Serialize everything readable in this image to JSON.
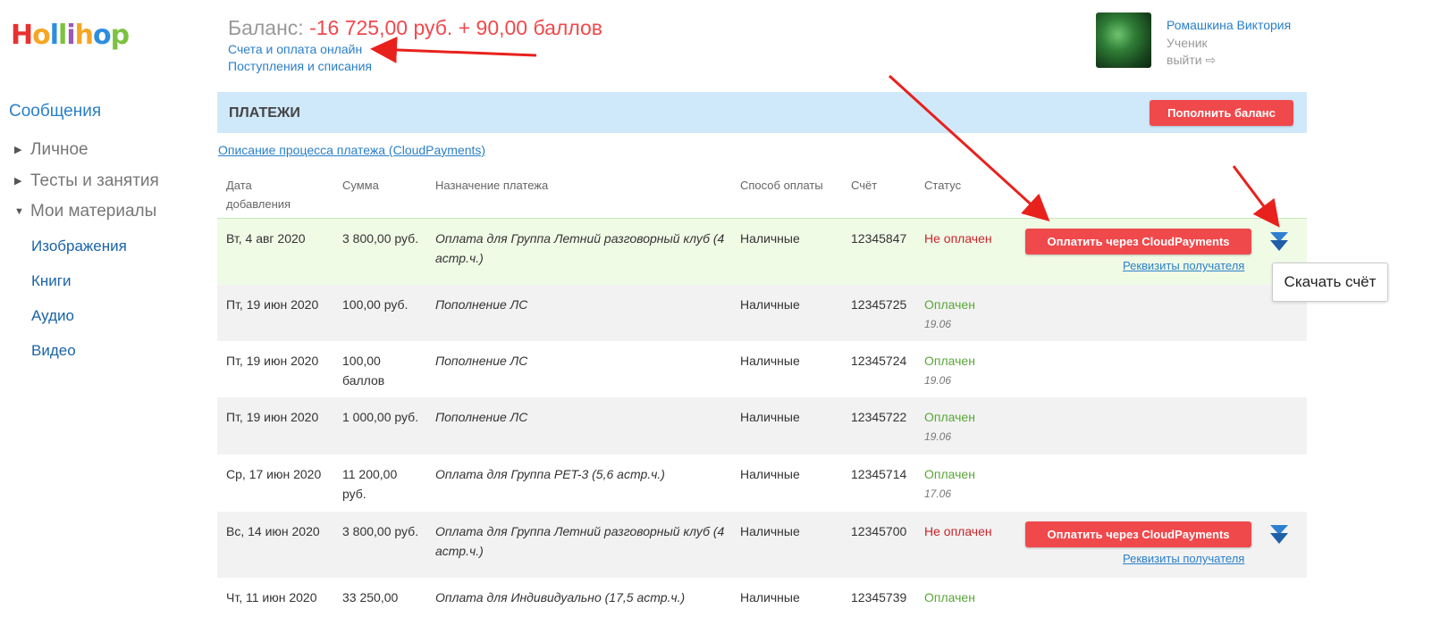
{
  "logo": {
    "letters": [
      "H",
      "o",
      "l",
      "l",
      "i",
      "h",
      "o",
      "p"
    ],
    "colors": [
      "#e8322f",
      "#f6a623",
      "#2d8ee0",
      "#7cc242",
      "#9b59b6",
      "#f6a623",
      "#2d8ee0",
      "#7cc242"
    ]
  },
  "header": {
    "balance_label": "Баланс: ",
    "balance_value": "-16 725,00 руб. + 90,00 баллов",
    "link_invoices": "Счета и оплата онлайн",
    "link_income": "Поступления и списания"
  },
  "user": {
    "name": "Ромашкина Виктория",
    "role": "Ученик",
    "exit": "выйти ⇨"
  },
  "sidebar": {
    "title": "Сообщения",
    "items": [
      {
        "label": "Личное",
        "icon": "triangle-right-icon"
      },
      {
        "label": "Тесты и занятия",
        "icon": "triangle-right-icon"
      },
      {
        "label": "Мои материалы",
        "icon": "triangle-down-icon"
      }
    ],
    "subitems": [
      "Изображения",
      "Книги",
      "Аудио",
      "Видео"
    ]
  },
  "panel": {
    "title": "ПЛАТЕЖИ",
    "topup_button": "Пополнить баланс"
  },
  "description_link": "Описание процесса платежа (CloudPayments)",
  "columns": [
    "Дата добавления",
    "Сумма",
    "Назначение платежа",
    "Способ оплаты",
    "Счёт",
    "Статус"
  ],
  "rows": [
    {
      "date": "Вт, 4 авг 2020",
      "amount": "3 800,00 руб.",
      "purpose": "Оплата для Группа Летний разговорный клуб (4 астр.ч.)",
      "method": "Наличные",
      "invoice": "12345847",
      "status": "Не оплачен",
      "paid": false,
      "status_date": "",
      "pay_button": "Оплатить через CloudPayments",
      "recipient_link": "Реквизиты получателя"
    },
    {
      "date": "Пт, 19 июн 2020",
      "amount": "100,00 руб.",
      "purpose": "Пополнение ЛС",
      "method": "Наличные",
      "invoice": "12345725",
      "status": "Оплачен",
      "paid": true,
      "status_date": "19.06"
    },
    {
      "date": "Пт, 19 июн 2020",
      "amount": "100,00 баллов",
      "purpose": "Пополнение ЛС",
      "method": "Наличные",
      "invoice": "12345724",
      "status": "Оплачен",
      "paid": true,
      "status_date": "19.06"
    },
    {
      "date": "Пт, 19 июн 2020",
      "amount": "1 000,00 руб.",
      "purpose": "Пополнение ЛС",
      "method": "Наличные",
      "invoice": "12345722",
      "status": "Оплачен",
      "paid": true,
      "status_date": "19.06"
    },
    {
      "date": "Ср, 17 июн 2020",
      "amount": "11 200,00 руб.",
      "purpose": "Оплата для Группа PET-3 (5,6 астр.ч.)",
      "method": "Наличные",
      "invoice": "12345714",
      "status": "Оплачен",
      "paid": true,
      "status_date": "17.06"
    },
    {
      "date": "Вс, 14 июн 2020",
      "amount": "3 800,00 руб.",
      "purpose": "Оплата для Группа Летний разговорный клуб (4 астр.ч.)",
      "method": "Наличные",
      "invoice": "12345700",
      "status": "Не оплачен",
      "paid": false,
      "status_date": "",
      "pay_button": "Оплатить через CloudPayments",
      "recipient_link": "Реквизиты получателя"
    },
    {
      "date": "Чт, 11 июн 2020",
      "amount": "33 250,00",
      "purpose": "Оплата для Индивидуально (17,5 астр.ч.)",
      "method": "Наличные",
      "invoice": "12345739",
      "status": "Оплачен",
      "paid": true,
      "status_date": ""
    }
  ],
  "tooltip": "Скачать счёт",
  "icons": {
    "download": "double-chevron-down-icon",
    "annotation": "red-arrow-icon"
  },
  "colors": {
    "accent_red": "#f0494c",
    "paid_green": "#5aa637",
    "unpaid_red": "#c9242a",
    "link_blue": "#2a7fc9",
    "header_bg": "#d0e9fa",
    "highlight_row": "#f0fbe6",
    "alt_row": "#f2f2f2"
  }
}
